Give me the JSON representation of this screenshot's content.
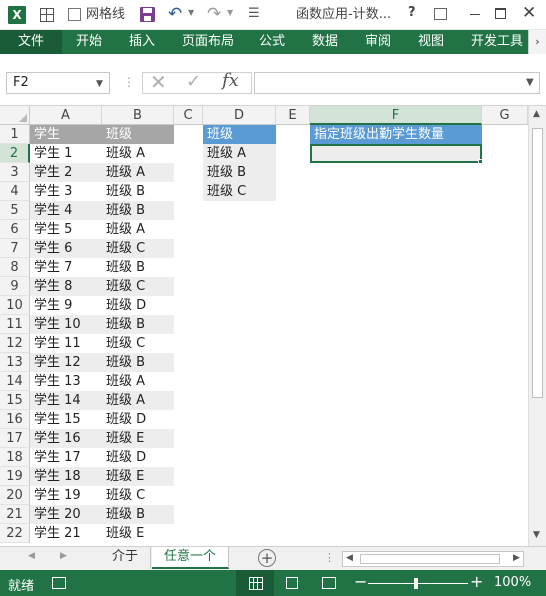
{
  "titlebar": {
    "app_icon": "excel-icon",
    "gridlines_label": "网格线",
    "title": "函数应用-计数...",
    "help": "?"
  },
  "ribbon": {
    "tabs": [
      "文件",
      "开始",
      "插入",
      "页面布局",
      "公式",
      "数据",
      "审阅",
      "视图",
      "开发工具"
    ]
  },
  "formula_bar": {
    "name_box": "F2",
    "fx": "fx",
    "content": ""
  },
  "grid": {
    "columns": [
      "A",
      "B",
      "C",
      "D",
      "E",
      "F",
      "G"
    ],
    "rows": [
      "1",
      "2",
      "3",
      "4",
      "5",
      "6",
      "7",
      "8",
      "9",
      "10",
      "11",
      "12",
      "13",
      "14",
      "15",
      "16",
      "17",
      "18",
      "19",
      "20",
      "21",
      "22"
    ],
    "selected_cell": "F2",
    "table1": {
      "headers": [
        "学生",
        "班级"
      ],
      "rows": [
        [
          "学生 1",
          "班级 A"
        ],
        [
          "学生 2",
          "班级 A"
        ],
        [
          "学生 3",
          "班级 B"
        ],
        [
          "学生 4",
          "班级 B"
        ],
        [
          "学生 5",
          "班级 A"
        ],
        [
          "学生 6",
          "班级 C"
        ],
        [
          "学生 7",
          "班级 B"
        ],
        [
          "学生 8",
          "班级 C"
        ],
        [
          "学生 9",
          "班级 D"
        ],
        [
          "学生 10",
          "班级 B"
        ],
        [
          "学生 11",
          "班级 C"
        ],
        [
          "学生 12",
          "班级 B"
        ],
        [
          "学生 13",
          "班级 A"
        ],
        [
          "学生 14",
          "班级 A"
        ],
        [
          "学生 15",
          "班级 D"
        ],
        [
          "学生 16",
          "班级 E"
        ],
        [
          "学生 17",
          "班级 D"
        ],
        [
          "学生 18",
          "班级 E"
        ],
        [
          "学生 19",
          "班级 C"
        ],
        [
          "学生 20",
          "班级 B"
        ],
        [
          "学生 21",
          "班级 E"
        ]
      ]
    },
    "table2": {
      "header": "班级",
      "rows": [
        "班级 A",
        "班级 B",
        "班级 C"
      ]
    },
    "f_header": "指定班级出勤学生数量"
  },
  "sheets": {
    "tabs": [
      "介于",
      "任意一个"
    ],
    "active": "任意一个"
  },
  "status": {
    "ready": "就绪",
    "zoom": "100%"
  },
  "colors": {
    "accent": "#217346",
    "header_gray": "#a6a6a6",
    "header_blue": "#5b9bd5",
    "band": "#ededed"
  }
}
